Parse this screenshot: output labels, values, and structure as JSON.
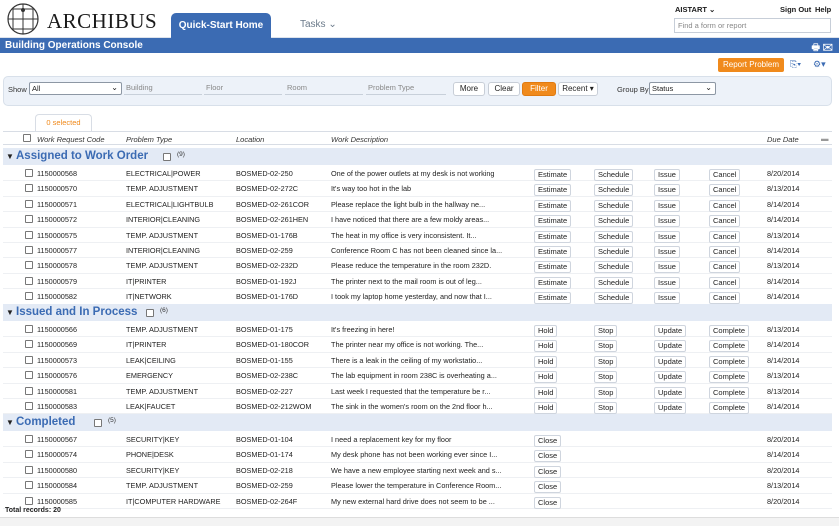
{
  "header": {
    "brand": "ARCHIBUS",
    "tabs": [
      {
        "label": "Quick-Start Home"
      },
      {
        "label": "Tasks ⌄"
      }
    ],
    "user": "AISTART ⌄",
    "sign_out": "Sign Out",
    "help": "Help",
    "search_placeholder": "Find a form or report"
  },
  "console": {
    "title": "Building Operations Console",
    "report_problem": "Report Problem",
    "icons": [
      "print-icon",
      "mail-icon",
      "export-icon",
      "settings-icon"
    ]
  },
  "filter": {
    "show_label": "Show",
    "show_value": "All",
    "building_placeholder": "Building",
    "floor_placeholder": "Floor",
    "room_placeholder": "Room",
    "problem_type_placeholder": "Problem Type",
    "more": "More",
    "clear": "Clear",
    "filter": "Filter",
    "recent": "Recent ▾",
    "group_by_label": "Group By",
    "group_by_value": "Status"
  },
  "grid": {
    "selected_tab": "0 selected",
    "columns": [
      "Work Request Code",
      "Problem Type",
      "Location",
      "Work Description",
      "Due Date"
    ],
    "groups": [
      {
        "title": "Assigned to Work Order",
        "count": "(9)",
        "actions": [
          "Estimate",
          "Schedule",
          "Issue",
          "Cancel"
        ],
        "rows": [
          {
            "code": "1150000568",
            "type": "ELECTRICAL|POWER",
            "location": "BOSMED-02-250",
            "desc": "One of the power outlets at my desk is not working",
            "due": "8/20/2014"
          },
          {
            "code": "1150000570",
            "type": "TEMP. ADJUSTMENT",
            "location": "BOSMED-02-272C",
            "desc": "It's way too hot in the lab",
            "due": "8/13/2014"
          },
          {
            "code": "1150000571",
            "type": "ELECTRICAL|LIGHTBULB",
            "location": "BOSMED-02-261COR",
            "desc": "Please replace the light bulb in the hallway ne...",
            "due": "8/14/2014"
          },
          {
            "code": "1150000572",
            "type": "INTERIOR|CLEANING",
            "location": "BOSMED-02-261HEN",
            "desc": "I have noticed that there are a few moldy areas...",
            "due": "8/14/2014"
          },
          {
            "code": "1150000575",
            "type": "TEMP. ADJUSTMENT",
            "location": "BOSMED-01-176B",
            "desc": "The heat in my office is very inconsistent. It...",
            "due": "8/13/2014"
          },
          {
            "code": "1150000577",
            "type": "INTERIOR|CLEANING",
            "location": "BOSMED-02-259",
            "desc": "Conference Room C has not been cleaned since la...",
            "due": "8/14/2014"
          },
          {
            "code": "1150000578",
            "type": "TEMP. ADJUSTMENT",
            "location": "BOSMED-02-232D",
            "desc": "Please reduce the temperature in the room 232D.",
            "due": "8/13/2014"
          },
          {
            "code": "1150000579",
            "type": "IT|PRINTER",
            "location": "BOSMED-01-192J",
            "desc": "The printer next to the mail room is out of leg...",
            "due": "8/14/2014"
          },
          {
            "code": "1150000582",
            "type": "IT|NETWORK",
            "location": "BOSMED-01-176D",
            "desc": "I took my laptop home yesterday, and now that I...",
            "due": "8/14/2014"
          }
        ]
      },
      {
        "title": "Issued and In Process",
        "count": "(6)",
        "actions": [
          "Hold",
          "Stop",
          "Update",
          "Complete"
        ],
        "rows": [
          {
            "code": "1150000566",
            "type": "TEMP. ADJUSTMENT",
            "location": "BOSMED-01-175",
            "desc": "It's freezing in here!",
            "due": "8/13/2014"
          },
          {
            "code": "1150000569",
            "type": "IT|PRINTER",
            "location": "BOSMED-01-180COR",
            "desc": "The printer near my office is not working. The...",
            "due": "8/14/2014"
          },
          {
            "code": "1150000573",
            "type": "LEAK|CEILING",
            "location": "BOSMED-01-155",
            "desc": "There is a leak in the ceiling of my workstatio...",
            "due": "8/14/2014"
          },
          {
            "code": "1150000576",
            "type": "EMERGENCY",
            "location": "BOSMED-02-238C",
            "desc": "The lab equipment in room 238C is overheating a...",
            "due": "8/13/2014"
          },
          {
            "code": "1150000581",
            "type": "TEMP. ADJUSTMENT",
            "location": "BOSMED-02-227",
            "desc": "Last week I requested that the temperature be r...",
            "due": "8/13/2014"
          },
          {
            "code": "1150000583",
            "type": "LEAK|FAUCET",
            "location": "BOSMED-02-212WOM",
            "desc": "The sink in the women's room on the 2nd floor h...",
            "due": "8/14/2014"
          }
        ]
      },
      {
        "title": "Completed",
        "count": "(5)",
        "actions": [
          "Close"
        ],
        "rows": [
          {
            "code": "1150000567",
            "type": "SECURITY|KEY",
            "location": "BOSMED-01-104",
            "desc": "I need a replacement key for my floor",
            "due": "8/20/2014"
          },
          {
            "code": "1150000574",
            "type": "PHONE|DESK",
            "location": "BOSMED-01-174",
            "desc": "My desk phone has not been working ever since I...",
            "due": "8/14/2014"
          },
          {
            "code": "1150000580",
            "type": "SECURITY|KEY",
            "location": "BOSMED-02-218",
            "desc": "We have a new employee starting next week and s...",
            "due": "8/20/2014"
          },
          {
            "code": "1150000584",
            "type": "TEMP. ADJUSTMENT",
            "location": "BOSMED-02-259",
            "desc": "Please lower the temperature in Conference Room...",
            "due": "8/13/2014"
          },
          {
            "code": "1150000585",
            "type": "IT|COMPUTER HARDWARE",
            "location": "BOSMED-02-264F",
            "desc": "My new external hard drive does not seem to be ...",
            "due": "8/20/2014"
          }
        ]
      }
    ],
    "total": "Total records: 20"
  }
}
